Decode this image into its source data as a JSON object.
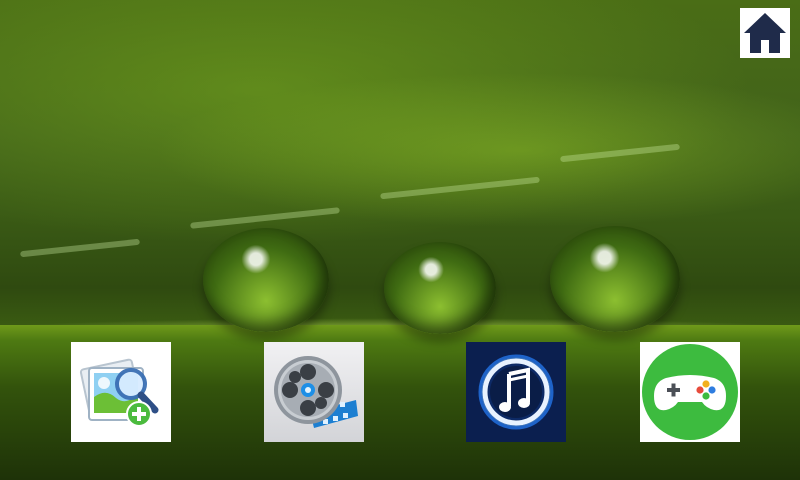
{
  "screen": {
    "wallpaper": "water-drops-on-green-leaf",
    "accent_colors": [
      "#4a6d16",
      "#6f9a1a",
      "#1e3208"
    ]
  },
  "top_bar": {
    "home_button": {
      "icon": "home-icon",
      "color": "#1f2b4a"
    }
  },
  "app_shortcuts": [
    {
      "id": "gallery",
      "icon": "photo-viewer-icon"
    },
    {
      "id": "video",
      "icon": "film-reel-icon"
    },
    {
      "id": "music",
      "icon": "music-note-icon"
    },
    {
      "id": "games",
      "icon": "gamepad-icon",
      "color": "#3dbb3f"
    }
  ]
}
